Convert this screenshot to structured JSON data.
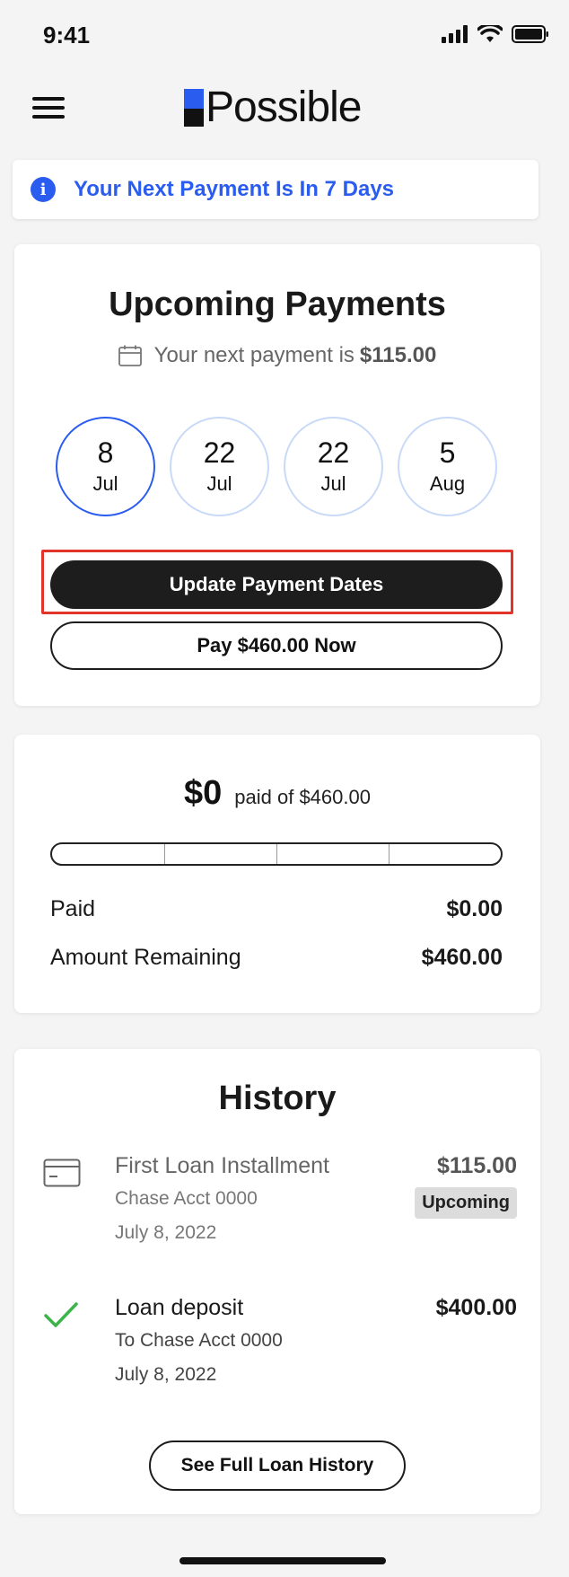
{
  "status_bar": {
    "time": "9:41"
  },
  "header": {
    "logo_text": "Possible",
    "brand_color": "#2a5cf0"
  },
  "banner": {
    "text": "Your Next Payment Is In 7 Days",
    "icon": "info-icon"
  },
  "upcoming": {
    "title": "Upcoming Payments",
    "next_prefix": "Your next payment is",
    "next_amount": "$115.00",
    "dates": [
      {
        "day": "8",
        "month": "Jul",
        "active": true
      },
      {
        "day": "22",
        "month": "Jul",
        "active": false
      },
      {
        "day": "22",
        "month": "Jul",
        "active": false
      },
      {
        "day": "5",
        "month": "Aug",
        "active": false
      }
    ],
    "update_button": "Update Payment Dates",
    "pay_button": "Pay $460.00 Now"
  },
  "progress": {
    "paid_amount": "$0",
    "paid_of": "paid of $460.00",
    "fraction": 0,
    "segments": 4,
    "paid_label": "Paid",
    "paid_value": "$0.00",
    "remaining_label": "Amount Remaining",
    "remaining_value": "$460.00"
  },
  "history": {
    "title": "History",
    "items": [
      {
        "name": "First Loan Installment",
        "account": "Chase Acct 0000",
        "date": "July 8, 2022",
        "amount": "$115.00",
        "badge": "Upcoming",
        "icon": "credit-card-icon"
      },
      {
        "name": "Loan deposit",
        "account": "To Chase Acct 0000",
        "date": "July 8, 2022",
        "amount": "$400.00",
        "icon": "checkmark-icon"
      }
    ],
    "full_history_button": "See Full Loan History"
  }
}
